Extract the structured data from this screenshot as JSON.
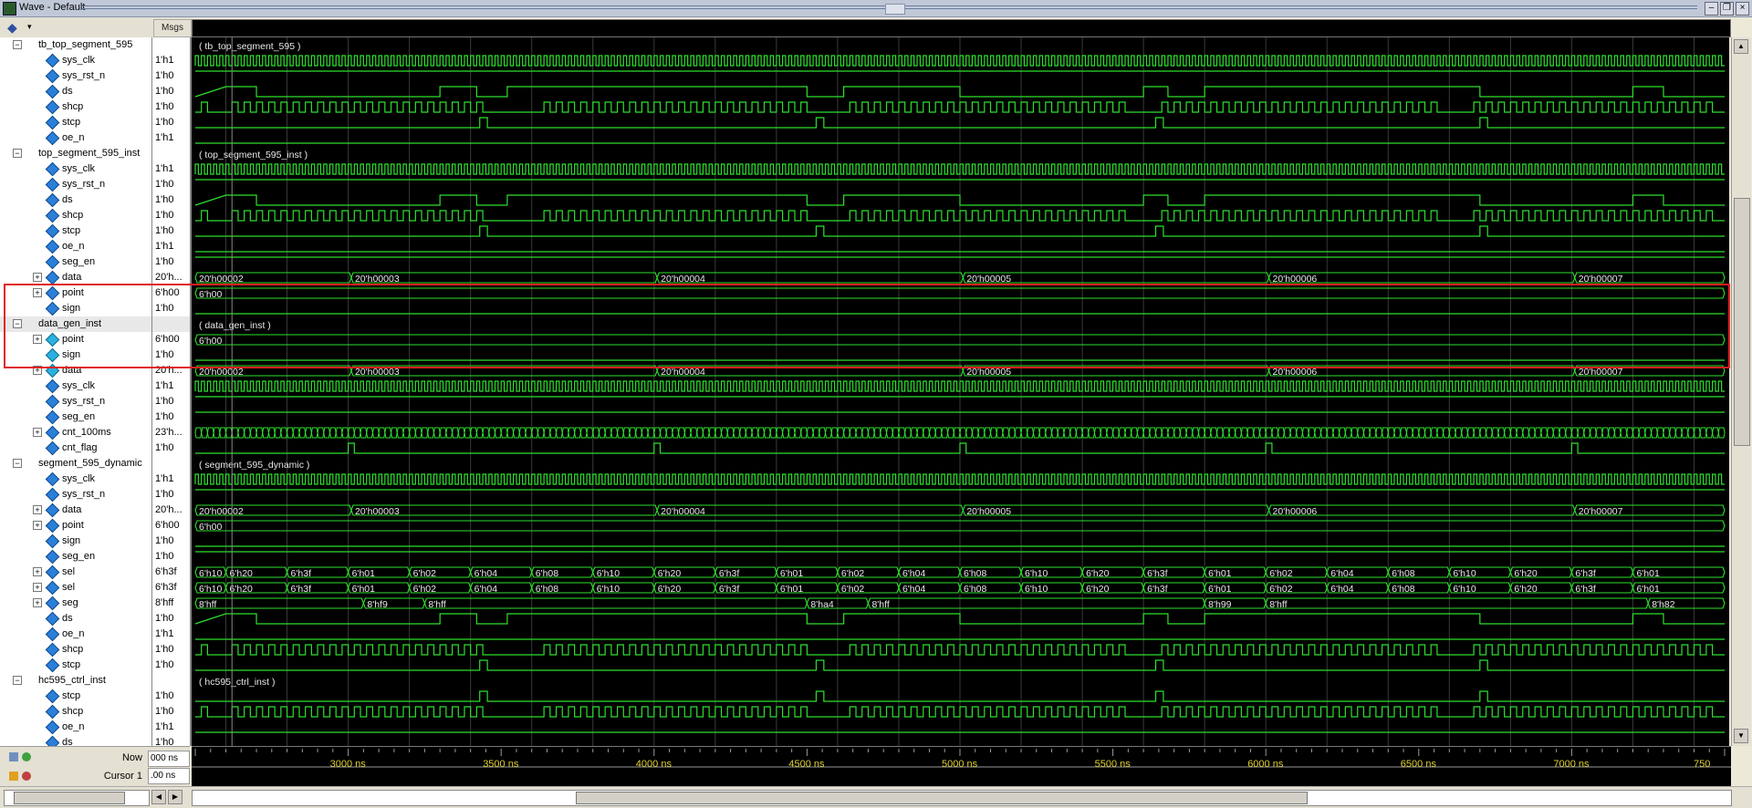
{
  "window": {
    "title": "Wave - Default"
  },
  "columns": {
    "msgs_header": "Msgs"
  },
  "signals": [
    {
      "name": "tb_top_segment_595",
      "value": "",
      "kind": "group",
      "indent": 0
    },
    {
      "name": "sys_clk",
      "value": "1'h1",
      "kind": "sig",
      "indent": 1
    },
    {
      "name": "sys_rst_n",
      "value": "1'h0",
      "kind": "sig",
      "indent": 1
    },
    {
      "name": "ds",
      "value": "1'h0",
      "kind": "sig",
      "indent": 1
    },
    {
      "name": "shcp",
      "value": "1'h0",
      "kind": "sig",
      "indent": 1
    },
    {
      "name": "stcp",
      "value": "1'h0",
      "kind": "sig",
      "indent": 1
    },
    {
      "name": "oe_n",
      "value": "1'h1",
      "kind": "sig",
      "indent": 1
    },
    {
      "name": "top_segment_595_inst",
      "value": "",
      "kind": "group",
      "indent": 0
    },
    {
      "name": "sys_clk",
      "value": "1'h1",
      "kind": "sig",
      "indent": 1
    },
    {
      "name": "sys_rst_n",
      "value": "1'h0",
      "kind": "sig",
      "indent": 1
    },
    {
      "name": "ds",
      "value": "1'h0",
      "kind": "sig",
      "indent": 1
    },
    {
      "name": "shcp",
      "value": "1'h0",
      "kind": "sig",
      "indent": 1
    },
    {
      "name": "stcp",
      "value": "1'h0",
      "kind": "sig",
      "indent": 1
    },
    {
      "name": "oe_n",
      "value": "1'h1",
      "kind": "sig",
      "indent": 1
    },
    {
      "name": "seg_en",
      "value": "1'h0",
      "kind": "sig",
      "indent": 1
    },
    {
      "name": "data",
      "value": "20'h...",
      "kind": "sig",
      "indent": 1,
      "bus": true
    },
    {
      "name": "point",
      "value": "6'h00",
      "kind": "sig",
      "indent": 1,
      "bus": true
    },
    {
      "name": "sign",
      "value": "1'h0",
      "kind": "sig",
      "indent": 1
    },
    {
      "name": "data_gen_inst",
      "value": "",
      "kind": "group",
      "indent": 0,
      "selected": true
    },
    {
      "name": "point",
      "value": "6'h00",
      "kind": "out",
      "indent": 1,
      "bus": true
    },
    {
      "name": "sign",
      "value": "1'h0",
      "kind": "out",
      "indent": 1
    },
    {
      "name": "data",
      "value": "20'h...",
      "kind": "out",
      "indent": 1,
      "bus": true
    },
    {
      "name": "sys_clk",
      "value": "1'h1",
      "kind": "sig",
      "indent": 1
    },
    {
      "name": "sys_rst_n",
      "value": "1'h0",
      "kind": "sig",
      "indent": 1
    },
    {
      "name": "seg_en",
      "value": "1'h0",
      "kind": "sig",
      "indent": 1
    },
    {
      "name": "cnt_100ms",
      "value": "23'h...",
      "kind": "sig",
      "indent": 1,
      "bus": true
    },
    {
      "name": "cnt_flag",
      "value": "1'h0",
      "kind": "sig",
      "indent": 1
    },
    {
      "name": "segment_595_dynamic",
      "value": "",
      "kind": "group",
      "indent": 0
    },
    {
      "name": "sys_clk",
      "value": "1'h1",
      "kind": "sig",
      "indent": 1
    },
    {
      "name": "sys_rst_n",
      "value": "1'h0",
      "kind": "sig",
      "indent": 1
    },
    {
      "name": "data",
      "value": "20'h...",
      "kind": "sig",
      "indent": 1,
      "bus": true
    },
    {
      "name": "point",
      "value": "6'h00",
      "kind": "sig",
      "indent": 1,
      "bus": true
    },
    {
      "name": "sign",
      "value": "1'h0",
      "kind": "sig",
      "indent": 1
    },
    {
      "name": "seg_en",
      "value": "1'h0",
      "kind": "sig",
      "indent": 1
    },
    {
      "name": "sel",
      "value": "6'h3f",
      "kind": "sig",
      "indent": 1,
      "bus": true
    },
    {
      "name": "sel",
      "value": "6'h3f",
      "kind": "sig",
      "indent": 1,
      "bus": true
    },
    {
      "name": "seg",
      "value": "8'hff",
      "kind": "sig",
      "indent": 1,
      "bus": true
    },
    {
      "name": "ds",
      "value": "1'h0",
      "kind": "sig",
      "indent": 1
    },
    {
      "name": "oe_n",
      "value": "1'h1",
      "kind": "sig",
      "indent": 1
    },
    {
      "name": "shcp",
      "value": "1'h0",
      "kind": "sig",
      "indent": 1
    },
    {
      "name": "stcp",
      "value": "1'h0",
      "kind": "sig",
      "indent": 1
    },
    {
      "name": "hc595_ctrl_inst",
      "value": "",
      "kind": "group",
      "indent": 0
    },
    {
      "name": "stcp",
      "value": "1'h0",
      "kind": "sig",
      "indent": 1
    },
    {
      "name": "shcp",
      "value": "1'h0",
      "kind": "sig",
      "indent": 1
    },
    {
      "name": "oe_n",
      "value": "1'h1",
      "kind": "sig",
      "indent": 1
    },
    {
      "name": "ds",
      "value": "1'h0",
      "kind": "sig",
      "indent": 1
    }
  ],
  "group_labels": {
    "tb": "( tb_top_segment_595 )",
    "top": "( top_segment_595_inst )",
    "dg": "( data_gen_inst )",
    "seg": "( segment_595_dynamic )",
    "hc": "( hc595_ctrl_inst )"
  },
  "data_values": [
    "20'h00002",
    "20'h00003",
    "20'h00004",
    "20'h00005",
    "20'h00006",
    "20'h00007"
  ],
  "point_value": "6'h00",
  "sel_values": [
    "6'h10",
    "6'h20",
    "6'h3f",
    "6'h01",
    "6'h02",
    "6'h04",
    "6'h08",
    "6'h10",
    "6'h20",
    "6'h3f",
    "6'h01",
    "6'h02",
    "6'h04",
    "6'h08",
    "6'h10",
    "6'h20",
    "6'h3f",
    "6'h01",
    "6'h02",
    "6'h04",
    "6'h08",
    "6'h10",
    "6'h20",
    "6'h3f",
    "6'h01"
  ],
  "seg_values": [
    "8'hff",
    "8'hf9",
    "8'hff",
    "8'ha4",
    "8'hff",
    "8'h99",
    "8'hff",
    "8'h82"
  ],
  "timeline": {
    "ticks": [
      "3000 ns",
      "3500 ns",
      "4000 ns",
      "4500 ns",
      "5000 ns",
      "5500 ns",
      "6000 ns",
      "6500 ns",
      "7000 ns",
      "750"
    ],
    "now_label": "Now",
    "now_value": "000 ns",
    "cursor_label": "Cursor 1",
    "cursor_value": ".00 ns"
  },
  "colors": {
    "wave": "#2ee02e",
    "background": "#000000",
    "highlight": "#e02020",
    "tick_text": "#e0d030"
  }
}
